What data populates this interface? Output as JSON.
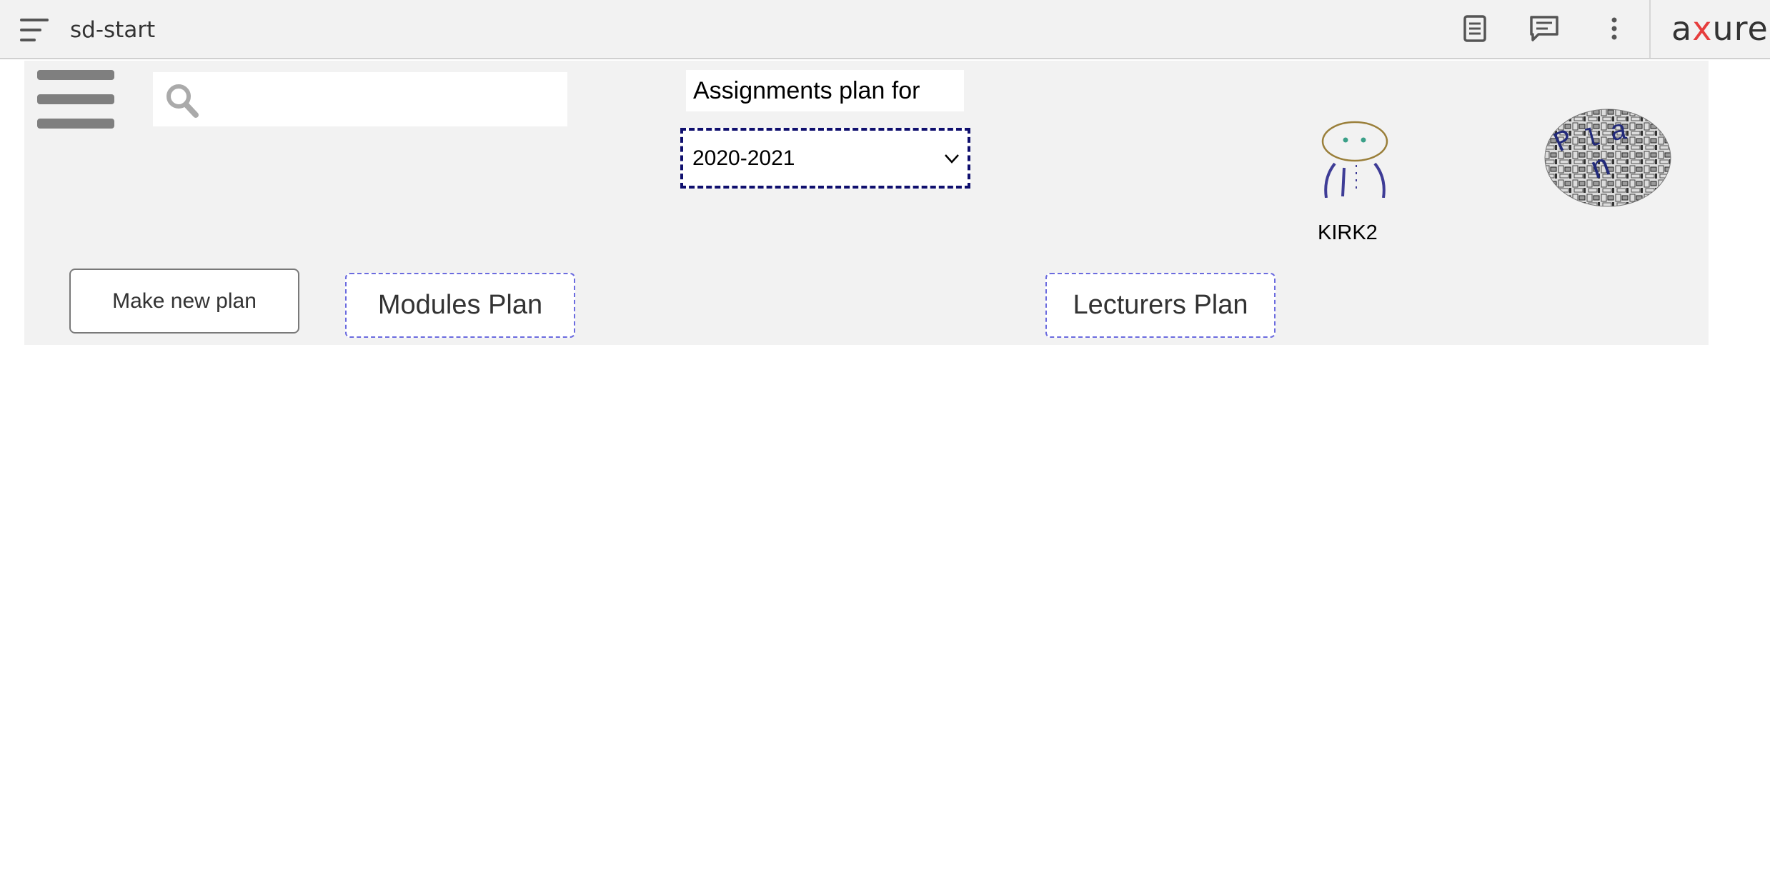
{
  "topbar": {
    "page_name": "sd-start",
    "brand": {
      "a": "a",
      "x": "x",
      "rest": "ure"
    },
    "brand_x_color": "#e63d3d",
    "icons": [
      "menu-icon",
      "page-notes-icon",
      "comments-icon",
      "more-options-icon"
    ]
  },
  "app": {
    "search": {
      "value": "",
      "placeholder": ""
    },
    "heading": "Assignments plan for",
    "year_select": {
      "selected": "2020-2021"
    },
    "user": {
      "name": "KIRK2"
    },
    "buttons": {
      "make_new_plan": "Make new plan",
      "modules_plan": "Modules Plan",
      "lecturers_plan": "Lecturers Plan"
    },
    "colors": {
      "canvas_bg": "#f2f2f2",
      "select_border": "#0f0f6e",
      "dashed_button_border": "#6b6bdf"
    }
  }
}
